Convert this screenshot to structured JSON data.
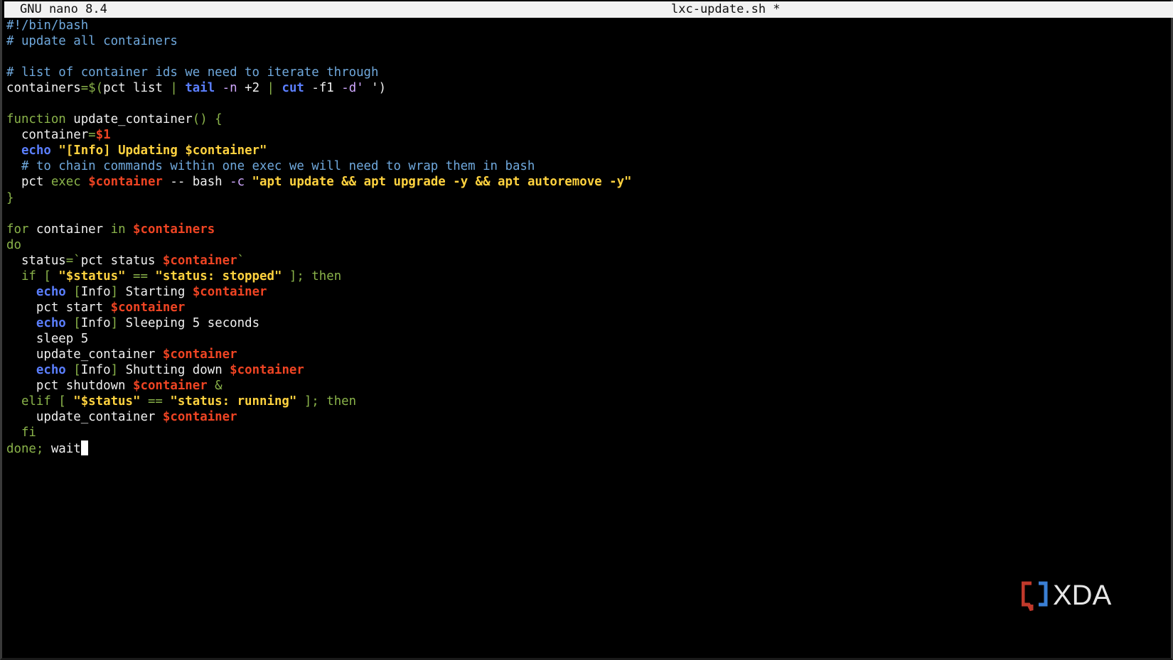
{
  "titlebar": {
    "app": "GNU nano 8.4",
    "filename": "lxc-update.sh *"
  },
  "editor": {
    "lines": [
      [
        {
          "t": "#!/bin/bash",
          "c": "cm"
        }
      ],
      [
        {
          "t": "# update all containers",
          "c": "cm"
        }
      ],
      [],
      [
        {
          "t": "# list of container ids we need to iterate through",
          "c": "cm"
        }
      ],
      [
        {
          "t": "containers",
          "c": "pl"
        },
        {
          "t": "=$(",
          "c": "kw"
        },
        {
          "t": "pct list ",
          "c": "pl"
        },
        {
          "t": "| ",
          "c": "kw"
        },
        {
          "t": "tail",
          "c": "bi"
        },
        {
          "t": " -n ",
          "c": "flag"
        },
        {
          "t": "+2 ",
          "c": "pl"
        },
        {
          "t": "| ",
          "c": "kw"
        },
        {
          "t": "cut",
          "c": "bi"
        },
        {
          "t": " -f1 ",
          "c": "pl"
        },
        {
          "t": "-d' ",
          "c": "flag"
        },
        {
          "t": "')",
          "c": "pl"
        }
      ],
      [],
      [
        {
          "t": "function ",
          "c": "kw"
        },
        {
          "t": "update_container",
          "c": "pl"
        },
        {
          "t": "() {",
          "c": "kw"
        }
      ],
      [
        {
          "t": "  container",
          "c": "pl"
        },
        {
          "t": "=",
          "c": "kw"
        },
        {
          "t": "$1",
          "c": "var"
        }
      ],
      [
        {
          "t": "  ",
          "c": "pl"
        },
        {
          "t": "echo",
          "c": "bi"
        },
        {
          "t": " ",
          "c": "pl"
        },
        {
          "t": "\"[Info] Updating $container\"",
          "c": "str"
        }
      ],
      [
        {
          "t": "  # to chain commands within one exec we will need to wrap them in bash",
          "c": "cm"
        }
      ],
      [
        {
          "t": "  pct ",
          "c": "pl"
        },
        {
          "t": "exec ",
          "c": "kw"
        },
        {
          "t": "$container",
          "c": "var"
        },
        {
          "t": " -- bash ",
          "c": "pl"
        },
        {
          "t": "-c ",
          "c": "flag"
        },
        {
          "t": "\"apt update && apt upgrade -y && apt autoremove -y\"",
          "c": "str"
        }
      ],
      [
        {
          "t": "}",
          "c": "kw"
        }
      ],
      [],
      [
        {
          "t": "for ",
          "c": "kw"
        },
        {
          "t": "container ",
          "c": "pl"
        },
        {
          "t": "in ",
          "c": "kw"
        },
        {
          "t": "$containers",
          "c": "var"
        }
      ],
      [
        {
          "t": "do",
          "c": "kw"
        }
      ],
      [
        {
          "t": "  status",
          "c": "pl"
        },
        {
          "t": "=`",
          "c": "kw"
        },
        {
          "t": "pct status ",
          "c": "pl"
        },
        {
          "t": "$container",
          "c": "var"
        },
        {
          "t": "`",
          "c": "kw"
        }
      ],
      [
        {
          "t": "  if [ ",
          "c": "kw"
        },
        {
          "t": "\"$status\"",
          "c": "str"
        },
        {
          "t": " == ",
          "c": "kw"
        },
        {
          "t": "\"status: stopped\"",
          "c": "str"
        },
        {
          "t": " ]; then",
          "c": "kw"
        }
      ],
      [
        {
          "t": "    ",
          "c": "pl"
        },
        {
          "t": "echo",
          "c": "bi"
        },
        {
          "t": " [",
          "c": "kw"
        },
        {
          "t": "Info",
          "c": "pl"
        },
        {
          "t": "] ",
          "c": "kw"
        },
        {
          "t": "Starting ",
          "c": "pl"
        },
        {
          "t": "$container",
          "c": "var"
        }
      ],
      [
        {
          "t": "    pct start ",
          "c": "pl"
        },
        {
          "t": "$container",
          "c": "var"
        }
      ],
      [
        {
          "t": "    ",
          "c": "pl"
        },
        {
          "t": "echo",
          "c": "bi"
        },
        {
          "t": " [",
          "c": "kw"
        },
        {
          "t": "Info",
          "c": "pl"
        },
        {
          "t": "] ",
          "c": "kw"
        },
        {
          "t": "Sleeping 5 seconds",
          "c": "pl"
        }
      ],
      [
        {
          "t": "    sleep 5",
          "c": "pl"
        }
      ],
      [
        {
          "t": "    update_container ",
          "c": "pl"
        },
        {
          "t": "$container",
          "c": "var"
        }
      ],
      [
        {
          "t": "    ",
          "c": "pl"
        },
        {
          "t": "echo",
          "c": "bi"
        },
        {
          "t": " [",
          "c": "kw"
        },
        {
          "t": "Info",
          "c": "pl"
        },
        {
          "t": "] ",
          "c": "kw"
        },
        {
          "t": "Shutting down ",
          "c": "pl"
        },
        {
          "t": "$container",
          "c": "var"
        }
      ],
      [
        {
          "t": "    pct shutdown ",
          "c": "pl"
        },
        {
          "t": "$container",
          "c": "var"
        },
        {
          "t": " &",
          "c": "kw"
        }
      ],
      [
        {
          "t": "  elif [ ",
          "c": "kw"
        },
        {
          "t": "\"$status\"",
          "c": "str"
        },
        {
          "t": " == ",
          "c": "kw"
        },
        {
          "t": "\"status: running\"",
          "c": "str"
        },
        {
          "t": " ]; then",
          "c": "kw"
        }
      ],
      [
        {
          "t": "    update_container ",
          "c": "pl"
        },
        {
          "t": "$container",
          "c": "var"
        }
      ],
      [
        {
          "t": "  fi",
          "c": "kw"
        }
      ],
      [
        {
          "t": "done; ",
          "c": "kw"
        },
        {
          "t": "wait",
          "c": "pl"
        }
      ]
    ]
  },
  "watermark": {
    "text": "XDA",
    "colors": {
      "bracket_left": "#c0392b",
      "bracket_right": "#3a7fd5",
      "text": "#e6e6e6"
    }
  },
  "colors": {
    "background": "#000000",
    "comment": "#6fa8dc",
    "keyword": "#8ab34a",
    "builtin": "#5b7fff",
    "variable": "#ef4423",
    "string": "#ffd23f",
    "text": "#f0f0f0"
  }
}
